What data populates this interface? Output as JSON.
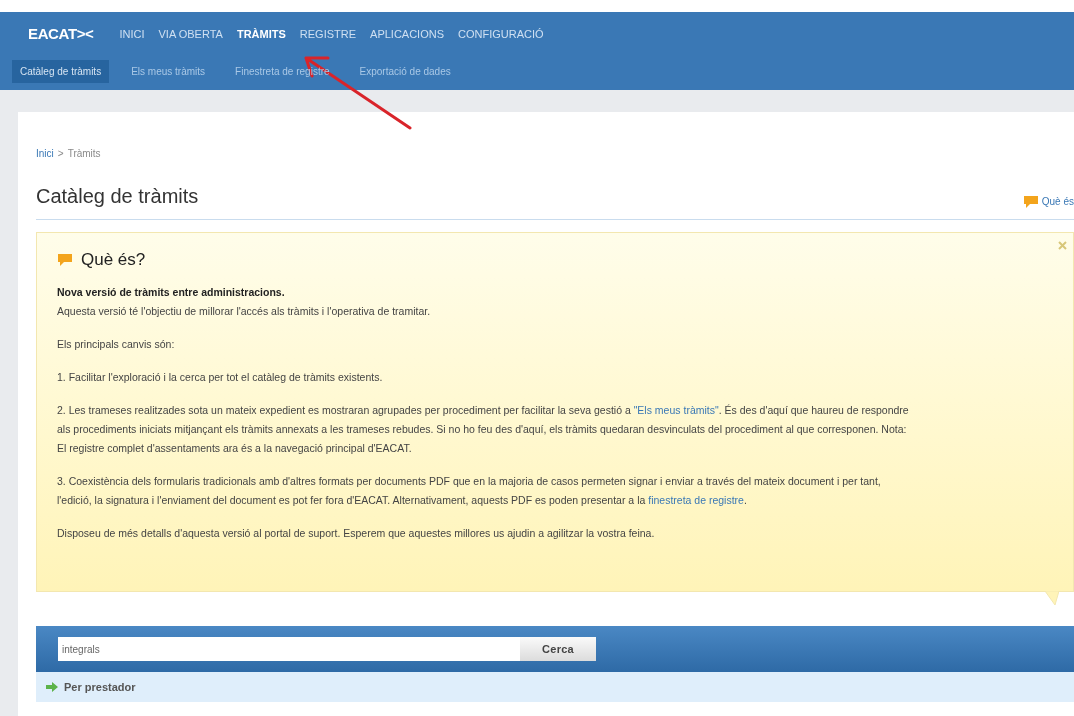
{
  "header": {
    "logo": "EACAT><",
    "nav": [
      {
        "label": "INICI",
        "selected": false
      },
      {
        "label": "VIA OBERTA",
        "selected": false
      },
      {
        "label": "TRÀMITS",
        "selected": true
      },
      {
        "label": "REGISTRE",
        "selected": false
      },
      {
        "label": "APLICACIONS",
        "selected": false
      },
      {
        "label": "CONFIGURACIÓ",
        "selected": false
      }
    ],
    "subtabs": [
      {
        "label": "Catàleg de tràmits",
        "selected": true
      },
      {
        "label": "Els meus tràmits",
        "selected": false
      },
      {
        "label": "Finestreta de registre",
        "selected": false
      },
      {
        "label": "Exportació de dades",
        "selected": false
      }
    ]
  },
  "breadcrumb": [
    {
      "label": "Inici",
      "link": true
    },
    {
      "label": ">",
      "link": false
    },
    {
      "label": "Tràmits",
      "link": false
    }
  ],
  "page_title": "Catàleg de tràmits",
  "help_link": "Què és",
  "info_box": {
    "title": "Què és?",
    "paragraphs": [
      {
        "lines": [
          [
            {
              "text": "Nova versió de tràmits entre administracions.",
              "bold": true
            }
          ],
          [
            {
              "text": "Aquesta versió té l'objectiu de millorar l'accés als tràmits i l'operativa de tramitar."
            }
          ]
        ]
      },
      {
        "lines": [
          [
            {
              "text": "Els principals canvis són:"
            }
          ]
        ]
      },
      {
        "lines": [
          [
            {
              "text": "1. Facilitar l'exploració i la cerca per tot el catàleg de tràmits existents."
            }
          ]
        ]
      },
      {
        "lines": [
          [
            {
              "text": "2. Les trameses realitzades sota un mateix expedient es mostraran agrupades per procediment per facilitar la seva gestió a "
            },
            {
              "text": "\"Els meus tràmits\"",
              "link": true
            },
            {
              "text": ". És des d'aquí que haureu de respondre"
            }
          ],
          [
            {
              "text": "als procediments iniciats mitjançant els tràmits annexats a les trameses rebudes. Si no ho feu des d'aquí, els tràmits quedaran desvinculats del procediment al que corresponen. Nota:"
            }
          ],
          [
            {
              "text": "El registre complet d'assentaments ara és a la navegació principal d'EACAT."
            }
          ]
        ]
      },
      {
        "lines": [
          [
            {
              "text": "3. Coexistència dels formularis tradicionals amb d'altres formats per documents PDF que en la majoria de casos permeten signar i enviar a través del mateix document i per tant,"
            }
          ],
          [
            {
              "text": "l'edició, la signatura i l'enviament del document es pot fer fora d'EACAT. Alternativament, aquests PDF es poden presentar a la "
            },
            {
              "text": "finestreta de registre",
              "link": true
            },
            {
              "text": "."
            }
          ]
        ]
      },
      {
        "lines": [
          [
            {
              "text": "Disposeu de més detalls d'aquesta versió al portal de suport. Esperem que aquestes millores us ajudin a agilitzar la vostra feina."
            }
          ]
        ]
      }
    ]
  },
  "search": {
    "value": "integrals",
    "button": "Cerca"
  },
  "section": {
    "label": "Per prestador"
  }
}
